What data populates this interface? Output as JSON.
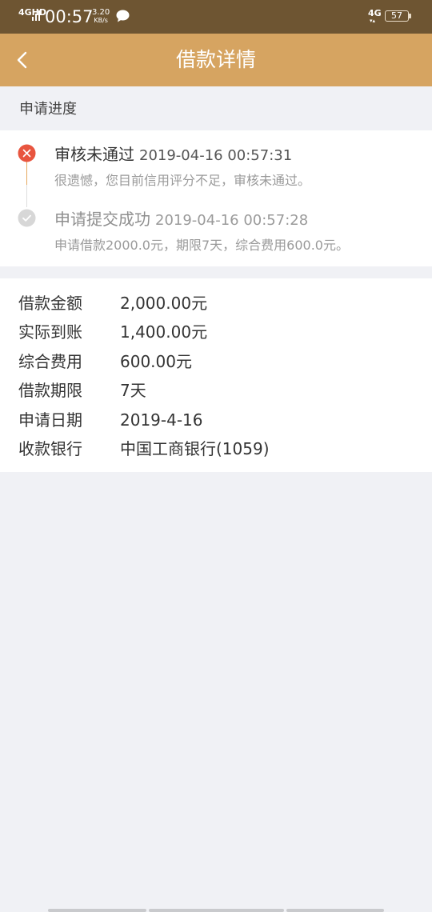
{
  "status_bar": {
    "network": "4GHD",
    "time": "00:57",
    "speed_value": "3.20",
    "speed_unit": "KB/s",
    "network2": "4G",
    "network2_arrows": "▾▴",
    "battery": "57",
    "icons": [
      "signal-icon",
      "chat-icon",
      "battery-icon"
    ]
  },
  "header": {
    "title": "借款详情",
    "back_icon": "chevron-left-icon"
  },
  "progress": {
    "section_label": "申请进度",
    "steps": [
      {
        "title": "审核未通过",
        "time": "2019-04-16 00:57:31",
        "desc": "很遗憾，您目前信用评分不足，审核未通过。",
        "status": "failed",
        "icon": "x-circle-icon",
        "color": "#e8553f"
      },
      {
        "title": "申请提交成功",
        "time": "2019-04-16 00:57:28",
        "desc": "申请借款2000.0元，期限7天，综合费用600.0元。",
        "status": "done",
        "icon": "check-circle-icon",
        "color": "#d7d7d7"
      }
    ]
  },
  "details": {
    "rows": [
      {
        "label": "借款金额",
        "value": "2,000.00元"
      },
      {
        "label": "实际到账",
        "value": "1,400.00元"
      },
      {
        "label": "综合费用",
        "value": "600.00元"
      },
      {
        "label": "借款期限",
        "value": "7天"
      },
      {
        "label": "申请日期",
        "value": "2019-4-16"
      },
      {
        "label": "收款银行",
        "value": "中国工商银行(1059)"
      }
    ]
  },
  "colors": {
    "header_bg": "#d6a461",
    "status_bar_bg": "#6e5532",
    "page_bg": "#f0f1f5",
    "error": "#e8553f",
    "accent_line": "#e6a95f"
  }
}
